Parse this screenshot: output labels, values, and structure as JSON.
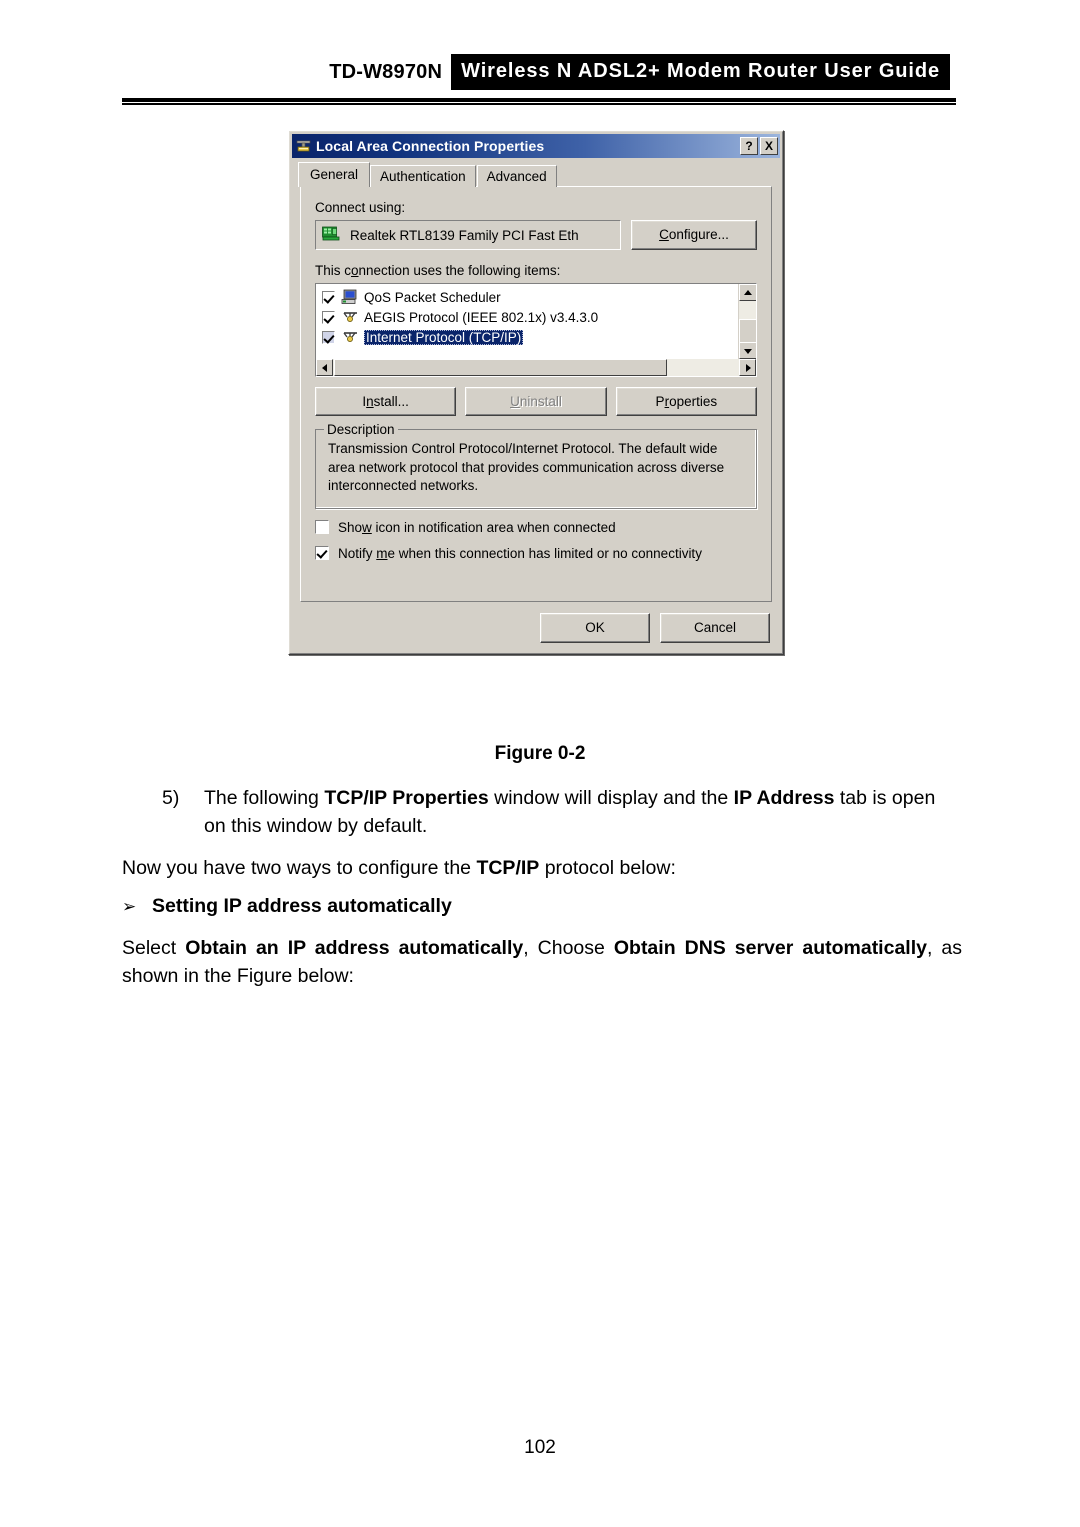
{
  "header": {
    "model": "TD-W8970N",
    "title": "Wireless N ADSL2+ Modem Router User Guide"
  },
  "dialog": {
    "title": "Local Area Connection   Properties",
    "titlebar_icon": "network-connection-icon",
    "help_button": "?",
    "close_button": "X",
    "tabs": [
      {
        "label": "General",
        "active": true
      },
      {
        "label": "Authentication",
        "active": false
      },
      {
        "label": "Advanced",
        "active": false
      }
    ],
    "connect_using_label": "Connect using:",
    "adapter": {
      "icon": "network-card-icon",
      "name": "Realtek RTL8139 Family PCI Fast Eth"
    },
    "configure_button": "Configure...",
    "items_label": "This connection uses the following items:",
    "items": [
      {
        "label": "QoS Packet Scheduler",
        "checked": true,
        "selected": false,
        "icon": "computer-icon"
      },
      {
        "label": "AEGIS Protocol (IEEE 802.1x) v3.4.3.0",
        "checked": true,
        "selected": false,
        "icon": "protocol-icon"
      },
      {
        "label": "Internet Protocol (TCP/IP)",
        "checked": true,
        "selected": true,
        "icon": "protocol-icon"
      }
    ],
    "buttons": {
      "install": "Install...",
      "uninstall": "Uninstall",
      "properties": "Properties"
    },
    "description": {
      "legend": "Description",
      "text": "Transmission Control Protocol/Internet Protocol. The default wide area network protocol that provides communication across diverse interconnected networks."
    },
    "options": [
      {
        "label": "Show icon in notification area when connected",
        "checked": false
      },
      {
        "label": "Notify me when this connection has limited or no connectivity",
        "checked": true
      }
    ],
    "ok_button": "OK",
    "cancel_button": "Cancel",
    "colors": {
      "face": "#d4d0c8",
      "titlebar_start": "#0a246a",
      "titlebar_end": "#9cb5dd",
      "selection": "#0a246a"
    }
  },
  "body": {
    "figure_caption": "Figure 0-2",
    "step5_number": "5)",
    "step5_text_1": "The following ",
    "step5_bold_1": "TCP/IP Properties",
    "step5_text_2": " window will display and the ",
    "step5_bold_2": "IP Address",
    "step5_text_3": " tab is open on this window by default.",
    "now_text_1": "Now you have two ways to configure the ",
    "now_bold": "TCP/IP",
    "now_text_2": " protocol below:",
    "bullet_glyph": "➢",
    "bullet_text": "Setting IP address automatically",
    "select_text_1": "Select ",
    "select_bold_1": "Obtain an IP address automatically",
    "select_text_2": ", Choose ",
    "select_bold_2": "Obtain DNS server automatically",
    "select_text_3": ", as shown in the Figure below:",
    "page_number": "102"
  }
}
